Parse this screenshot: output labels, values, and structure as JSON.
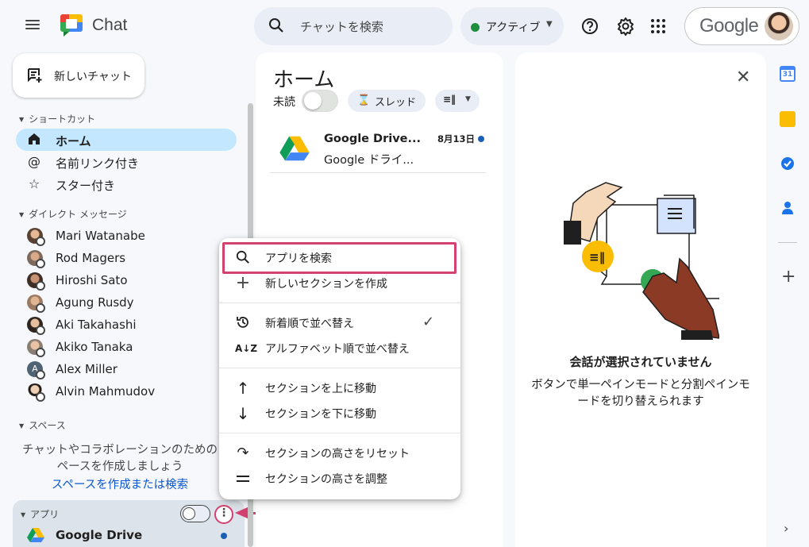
{
  "header": {
    "app_name": "Chat",
    "search_placeholder": "チャットを検索",
    "status_label": "アクティブ",
    "account_brand": "Google"
  },
  "sidebar": {
    "new_chat_label": "新しいチャット",
    "shortcuts_heading": "ショートカット",
    "shortcuts": [
      {
        "label": "ホーム",
        "icon": "home-icon",
        "active": true
      },
      {
        "label": "名前リンク付き",
        "icon": "at-icon"
      },
      {
        "label": "スター付き",
        "icon": "star-icon"
      }
    ],
    "dm_heading": "ダイレクト メッセージ",
    "dms": [
      {
        "name": "Mari Watanabe"
      },
      {
        "name": "Rod Magers"
      },
      {
        "name": "Hiroshi Sato"
      },
      {
        "name": "Agung Rusdy"
      },
      {
        "name": "Aki Takahashi"
      },
      {
        "name": "Akiko Tanaka"
      },
      {
        "name": "Alex Miller",
        "initial": "A"
      },
      {
        "name": "Alvin Mahmudov"
      }
    ],
    "spaces_heading": "スペース",
    "spaces_desc_line1": "チャットやコラボレーションのための",
    "spaces_desc_line2": "ペースを作成しましょう",
    "spaces_link": "スペースを作成または検索",
    "apps_heading": "アプリ",
    "apps": [
      {
        "name": "Google Drive",
        "unread": true
      }
    ]
  },
  "home": {
    "title": "ホーム",
    "unread_label": "未読",
    "thread_chip": "スレッド",
    "conversations": [
      {
        "title": "Google Drive...",
        "preview": "Google ドライ...",
        "date": "8月13日",
        "unread": true
      }
    ]
  },
  "empty_state": {
    "title": "会話が選択されていません",
    "desc_line1": "ボタンで単一ペインモードと分割ペインモ",
    "desc_line2": "ードを切り替えられます"
  },
  "context_menu": {
    "items": [
      {
        "label": "アプリを検索",
        "icon": "search-icon"
      },
      {
        "label": "新しいセクションを作成",
        "icon": "plus-icon"
      },
      {
        "label": "新着順で並べ替え",
        "icon": "history-icon",
        "checked": true
      },
      {
        "label": "アルファベット順で並べ替え",
        "icon": "sort-az-icon"
      },
      {
        "label": "セクションを上に移動",
        "icon": "arrow-up-icon"
      },
      {
        "label": "セクションを下に移動",
        "icon": "arrow-down-icon"
      },
      {
        "label": "セクションの高さをリセット",
        "icon": "redo-icon"
      },
      {
        "label": "セクションの高さを調整",
        "icon": "drag-handle-icon"
      }
    ]
  },
  "colors": {
    "accent": "#0b57d0",
    "active_bg": "#c2e7ff",
    "highlight": "#d5416f",
    "status_green": "#1e8e3e"
  }
}
